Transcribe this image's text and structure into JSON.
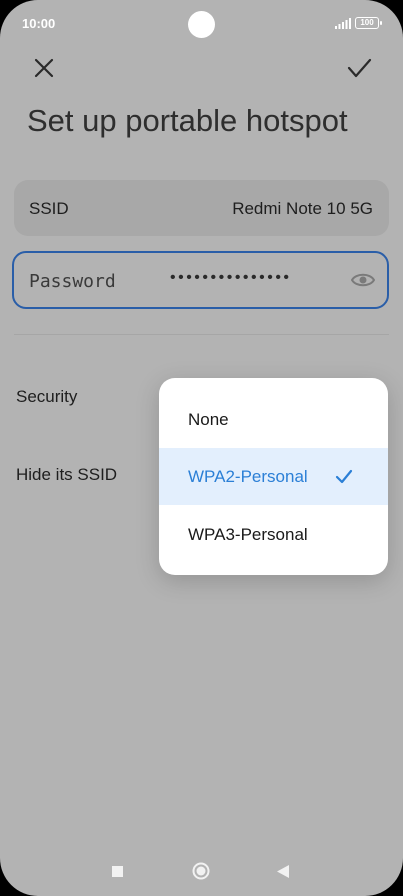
{
  "status_bar": {
    "time": "10:00",
    "battery": "100",
    "icons": [
      "camera-cutout",
      "signal-icon",
      "battery-icon"
    ]
  },
  "toolbar": {
    "close_icon": "close-icon",
    "confirm_icon": "check-icon"
  },
  "page": {
    "title": "Set up portable hotspot"
  },
  "ssid": {
    "label": "SSID",
    "value": "Redmi Note 10 5G"
  },
  "password": {
    "label": "Password",
    "masked_value": "•••••••••••••••",
    "visibility_icon": "eye-icon"
  },
  "settings": {
    "security_label": "Security",
    "hide_ssid_label": "Hide its SSID"
  },
  "dropdown": {
    "options": [
      {
        "label": "None",
        "selected": false
      },
      {
        "label": "WPA2-Personal",
        "selected": true
      },
      {
        "label": "WPA3-Personal",
        "selected": false
      }
    ]
  },
  "colors": {
    "accent": "#2b7fd6",
    "focus_border": "#2a5ea8",
    "selected_bg": "#e3effd",
    "scrim_bg": "#b3b3b3"
  },
  "nav_bar": {
    "icons": [
      "recents-square-icon",
      "home-circle-icon",
      "back-triangle-icon"
    ]
  }
}
